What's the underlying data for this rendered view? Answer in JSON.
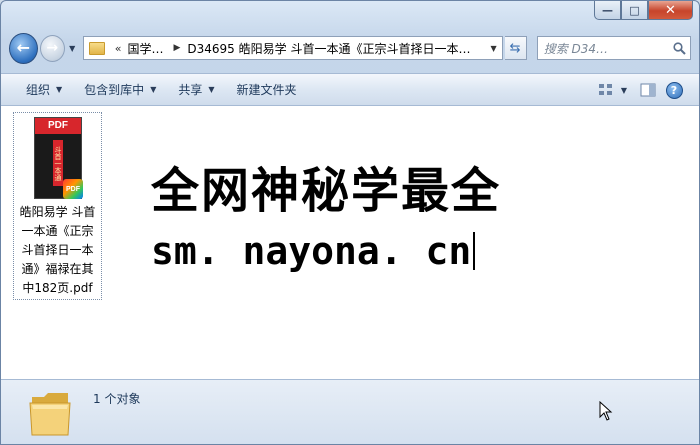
{
  "window": {
    "caption": {
      "minimize": "—",
      "maximize": "□",
      "close": "✕"
    }
  },
  "nav": {
    "back": "←",
    "forward": "→",
    "history_dropdown": "▼",
    "address": {
      "overflow_chevron": "«",
      "crumb_root": "国学…",
      "separator": "▶",
      "current_path": "D34695 皓阳易学 斗首一本通《正宗斗首择日一本…",
      "dropdown": "▼"
    },
    "refresh": "⇆",
    "search": {
      "placeholder": "搜索 D34…"
    }
  },
  "toolbar": {
    "organize": "组织",
    "include_in_library": "包含到库中",
    "share": "共享",
    "new_folder": "新建文件夹",
    "dropdown_glyph": "▼",
    "help": "?"
  },
  "file": {
    "cover_band": "PDF",
    "cover_title": "斗首一本通",
    "badge": "PDF",
    "name": "皓阳易学 斗首一本通《正宗斗首择日一本通》福禄在其中182页.pdf"
  },
  "banner": {
    "line1": "全网神秘学最全",
    "line2": "sm. nayona. cn"
  },
  "details": {
    "status": "1 个对象"
  },
  "colors": {
    "accent": "#2d6fbe",
    "close_button": "#c7442b",
    "pdf_red": "#d7262c"
  },
  "icons": {
    "back": "back-arrow-icon",
    "forward": "forward-arrow-icon",
    "folder": "folder-icon",
    "refresh": "refresh-icon",
    "search": "search-icon",
    "views": "view-options-icon",
    "preview": "preview-pane-icon",
    "help": "help-icon",
    "cursor": "mouse-cursor-icon"
  }
}
